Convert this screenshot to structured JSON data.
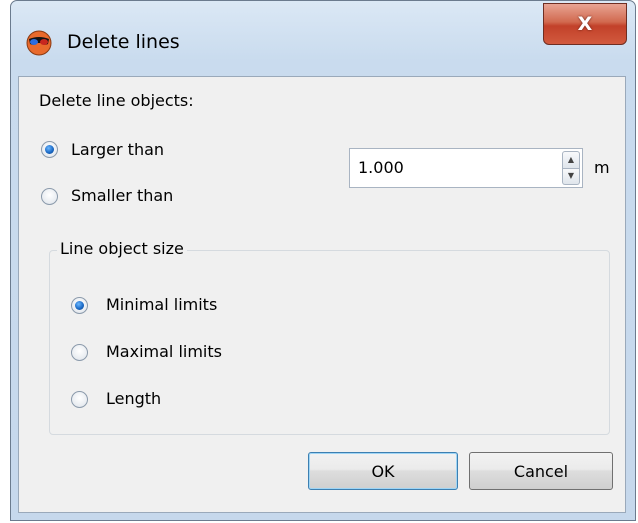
{
  "dialog": {
    "title": "Delete lines",
    "close_label": "X",
    "delete_section_label": "Delete line objects:",
    "mode_options": [
      {
        "label": "Larger than",
        "selected": true
      },
      {
        "label": "Smaller than",
        "selected": false
      }
    ],
    "size_value": "1.000",
    "size_unit": "m",
    "group_title": "Line object size",
    "size_options": [
      {
        "label": "Minimal limits",
        "selected": true
      },
      {
        "label": "Maximal limits",
        "selected": false
      },
      {
        "label": "Length",
        "selected": false
      }
    ],
    "ok_label": "OK",
    "cancel_label": "Cancel"
  },
  "icons": {
    "app": "sunglasses-globe-icon",
    "close": "close-icon",
    "spin_up": "arrow-up-icon",
    "spin_down": "arrow-down-icon"
  },
  "colors": {
    "titlebar": "#c9dbee",
    "close_button": "#c2412a",
    "dialog_bg": "#f0f0f0",
    "radio_selected": "#1c6bc7"
  }
}
